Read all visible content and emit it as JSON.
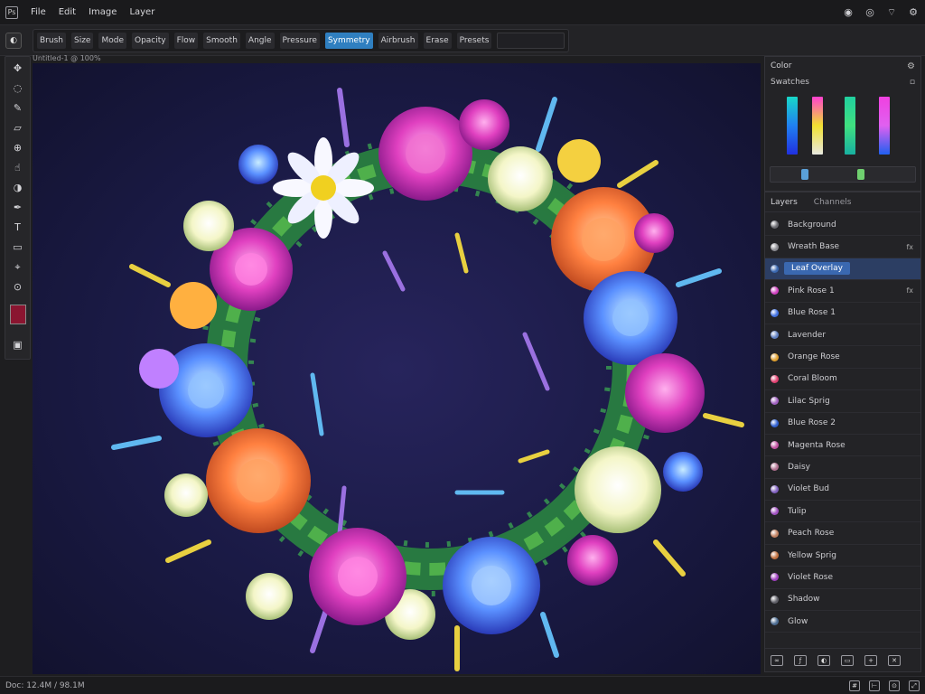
{
  "menubar": {
    "app_icon": "app-logo-icon",
    "menus": [
      "File",
      "Edit",
      "Image",
      "Layer"
    ],
    "tray_icons": [
      "globe-icon",
      "eye-icon",
      "wifi-icon",
      "settings-icon"
    ]
  },
  "options": {
    "items": [
      "Brush",
      "Size",
      "Mode",
      "Opacity",
      "Flow",
      "Smooth",
      "Angle",
      "Pressure",
      "Symmetry",
      "Airbrush",
      "Erase",
      "Presets"
    ],
    "active_index": 8,
    "field_value": ""
  },
  "document": {
    "tab_label": "Untitled-1 @ 100%"
  },
  "tools": [
    "move",
    "lasso",
    "brush",
    "eraser",
    "clone",
    "smudge",
    "dodge",
    "pen",
    "text",
    "shape",
    "eyedropper",
    "zoom"
  ],
  "foreground_color": "#8a1530",
  "colors": {
    "panel_title": "Color",
    "sub_label": "Swatches",
    "bar_gradients": [
      [
        "#18d8c8",
        "#2080f0",
        "#2030e0"
      ],
      [
        "#ff40d0",
        "#f0e030",
        "#e8e8e0"
      ],
      [
        "#20d0a0",
        "#40e080",
        "#18b0a0"
      ],
      [
        "#f040e0",
        "#e060f0",
        "#2060f0"
      ]
    ],
    "slider_knobs": [
      "#5aa0d8",
      "#70d070"
    ]
  },
  "layers": {
    "tabs": [
      "Layers",
      "Channels"
    ],
    "items": [
      {
        "name": "Background",
        "color": "#6a6a70",
        "badge": ""
      },
      {
        "name": "Wreath Base",
        "color": "#8a8a90",
        "badge": "fx"
      },
      {
        "name": "Leaf Overlay",
        "color": "#3a68b0",
        "badge": "",
        "selected": true
      },
      {
        "name": "Pink Rose 1",
        "color": "#d040c0",
        "badge": "fx"
      },
      {
        "name": "Blue Rose 1",
        "color": "#4070e0",
        "badge": ""
      },
      {
        "name": "Lavender",
        "color": "#6080c0",
        "badge": ""
      },
      {
        "name": "Orange Rose",
        "color": "#e0a030",
        "badge": ""
      },
      {
        "name": "Coral Bloom",
        "color": "#e04070",
        "badge": ""
      },
      {
        "name": "Lilac Sprig",
        "color": "#a060c0",
        "badge": ""
      },
      {
        "name": "Blue Rose 2",
        "color": "#3060d0",
        "badge": ""
      },
      {
        "name": "Magenta Rose",
        "color": "#c050a0",
        "badge": ""
      },
      {
        "name": "Daisy",
        "color": "#b07090",
        "badge": ""
      },
      {
        "name": "Violet Bud",
        "color": "#8060c0",
        "badge": ""
      },
      {
        "name": "Tulip",
        "color": "#a050c0",
        "badge": ""
      },
      {
        "name": "Peach Rose",
        "color": "#c08060",
        "badge": ""
      },
      {
        "name": "Yellow Sprig",
        "color": "#c07040",
        "badge": ""
      },
      {
        "name": "Violet Rose",
        "color": "#a040c0",
        "badge": ""
      },
      {
        "name": "Shadow",
        "color": "#606068",
        "badge": ""
      },
      {
        "name": "Glow",
        "color": "#4a6a90",
        "badge": ""
      }
    ],
    "footer_icons": [
      "link-icon",
      "fx-icon",
      "mask-icon",
      "folder-icon",
      "new-layer-icon",
      "trash-icon"
    ]
  },
  "status": {
    "text": "Doc: 12.4M / 98.1M",
    "icons": [
      "grid-icon",
      "ruler-icon",
      "zoom-icon",
      "fullscreen-icon"
    ]
  }
}
